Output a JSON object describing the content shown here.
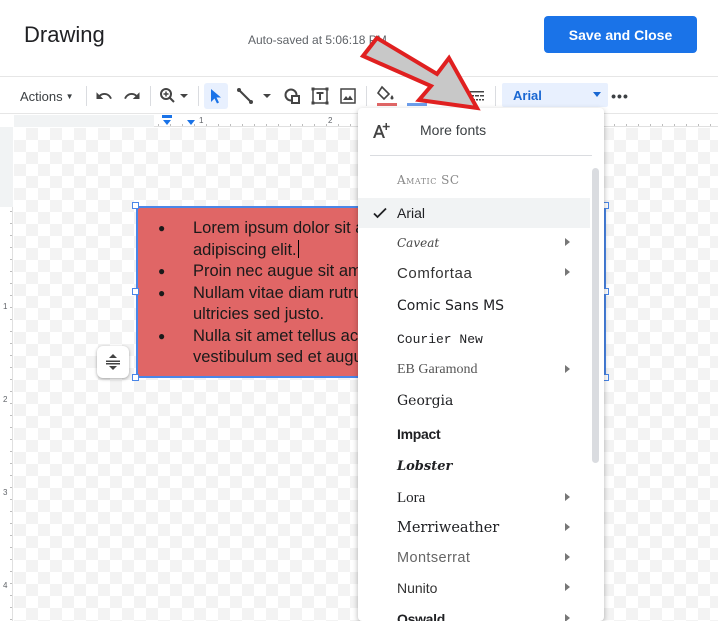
{
  "header": {
    "title": "Drawing",
    "autosave": "Auto-saved at 5:06:18 PM",
    "save_close_label": "Save and Close"
  },
  "toolbar": {
    "actions_label": "Actions",
    "font_name": "Arial",
    "icons": [
      "undo-icon",
      "redo-icon",
      "zoom-icon",
      "select-cursor-icon",
      "line-icon",
      "shape-icon",
      "text-box-icon",
      "image-icon",
      "fill-color-icon",
      "border-color-icon",
      "border-weight-icon",
      "border-dash-icon",
      "more-options-icon"
    ],
    "fill_color": "#e06666",
    "border_color": "#6d9eeb"
  },
  "rulers": {
    "top_numbers": [
      "1",
      "2"
    ],
    "left_numbers": [
      "1",
      "2",
      "3",
      "4"
    ]
  },
  "textbox": {
    "fill": "#e06666",
    "bullets": [
      {
        "line1": "Lorem ipsum dolor sit amet, consectetur",
        "line2": "adipiscing elit."
      },
      {
        "line1": "Proin nec augue sit amet lorem",
        "line2": ""
      },
      {
        "line1": "Nullam vitae diam rutrum, aliquam",
        "line2": "ultricies sed justo."
      },
      {
        "line1": "Nulla sit amet tellus ac dolor",
        "line2": "vestibulum sed et augue."
      }
    ]
  },
  "font_menu": {
    "more_fonts_label": "More fonts",
    "selected": "Arial",
    "items": [
      {
        "label": "Amatic SC",
        "submenu": false
      },
      {
        "label": "Arial",
        "submenu": false
      },
      {
        "label": "Caveat",
        "submenu": true
      },
      {
        "label": "Comfortaa",
        "submenu": true
      },
      {
        "label": "Comic Sans MS",
        "submenu": false
      },
      {
        "label": "Courier New",
        "submenu": false
      },
      {
        "label": "EB Garamond",
        "submenu": true
      },
      {
        "label": "Georgia",
        "submenu": false
      },
      {
        "label": "Impact",
        "submenu": false
      },
      {
        "label": "Lobster",
        "submenu": false
      },
      {
        "label": "Lora",
        "submenu": true
      },
      {
        "label": "Merriweather",
        "submenu": true
      },
      {
        "label": "Montserrat",
        "submenu": true
      },
      {
        "label": "Nunito",
        "submenu": true
      },
      {
        "label": "Oswald",
        "submenu": true
      }
    ]
  },
  "annotation": {
    "arrow_color": "#e02020",
    "arrow_fill": "#c8c8c8"
  }
}
